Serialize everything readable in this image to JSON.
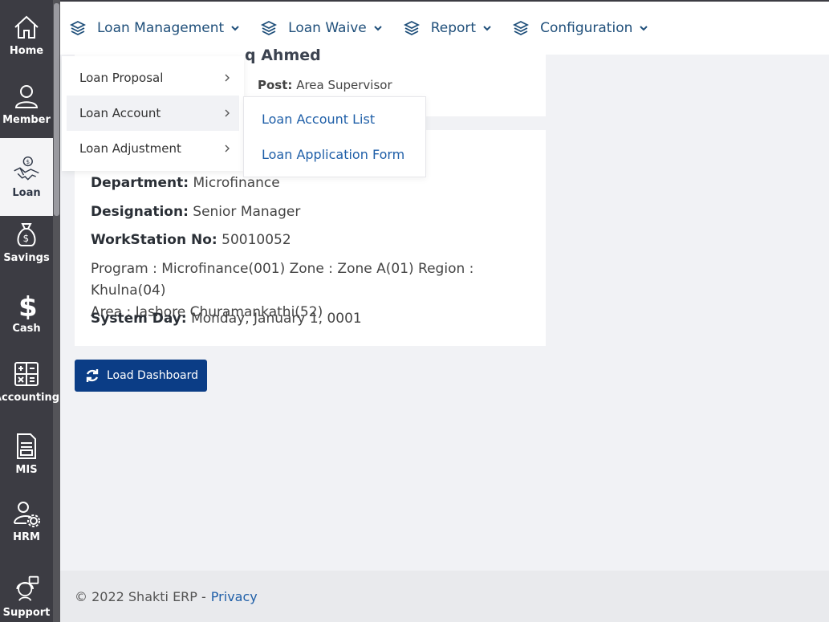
{
  "sidebar": {
    "items": [
      {
        "label": "Home",
        "icon": "home-icon"
      },
      {
        "label": "Member",
        "icon": "user-icon"
      },
      {
        "label": "Loan",
        "icon": "handshake-coin-icon",
        "active": true
      },
      {
        "label": "Savings",
        "icon": "money-bag-icon"
      },
      {
        "label": "Cash",
        "icon": "dollar-icon"
      },
      {
        "label": "Accounting",
        "icon": "calculator-icon"
      },
      {
        "label": "MIS",
        "icon": "report-icon"
      },
      {
        "label": "HRM",
        "icon": "user-gear-icon"
      },
      {
        "label": "Support",
        "icon": "support-icon"
      }
    ]
  },
  "topnav": {
    "items": [
      {
        "label": "Loan Management"
      },
      {
        "label": "Loan Waive"
      },
      {
        "label": "Report"
      },
      {
        "label": "Configuration"
      }
    ]
  },
  "profile": {
    "name_fragment": "q Ahmed",
    "post_label": "Post:",
    "post_value": "Area Supervisor"
  },
  "details": {
    "department_label": "Department:",
    "department_value": "Microfinance",
    "designation_label": "Designation:",
    "designation_value": "Senior Manager",
    "workstation_label": "WorkStation No:",
    "workstation_value": "50010052",
    "program_line1": "Program : Microfinance(001) Zone : Zone A(01) Region : Khulna(04)",
    "program_line2": "Area : Jashore Churamankathi(52)",
    "systemday_label": "System Day:",
    "systemday_value": "Monday, January 1, 0001"
  },
  "load_button": {
    "label": "Load Dashboard"
  },
  "dropdown": {
    "items": [
      {
        "label": "Loan Proposal"
      },
      {
        "label": "Loan Account"
      },
      {
        "label": "Loan Adjustment"
      }
    ],
    "submenu": [
      {
        "label": "Loan Account List"
      },
      {
        "label": "Loan Application Form"
      }
    ]
  },
  "footer": {
    "copyright": "© 2022 Shakti ERP -",
    "privacy": "Privacy"
  },
  "colors": {
    "sidebar": "#3c3c43",
    "nav_text": "#1f4f7a",
    "button": "#0b3d86",
    "link": "#1f5fa8"
  }
}
